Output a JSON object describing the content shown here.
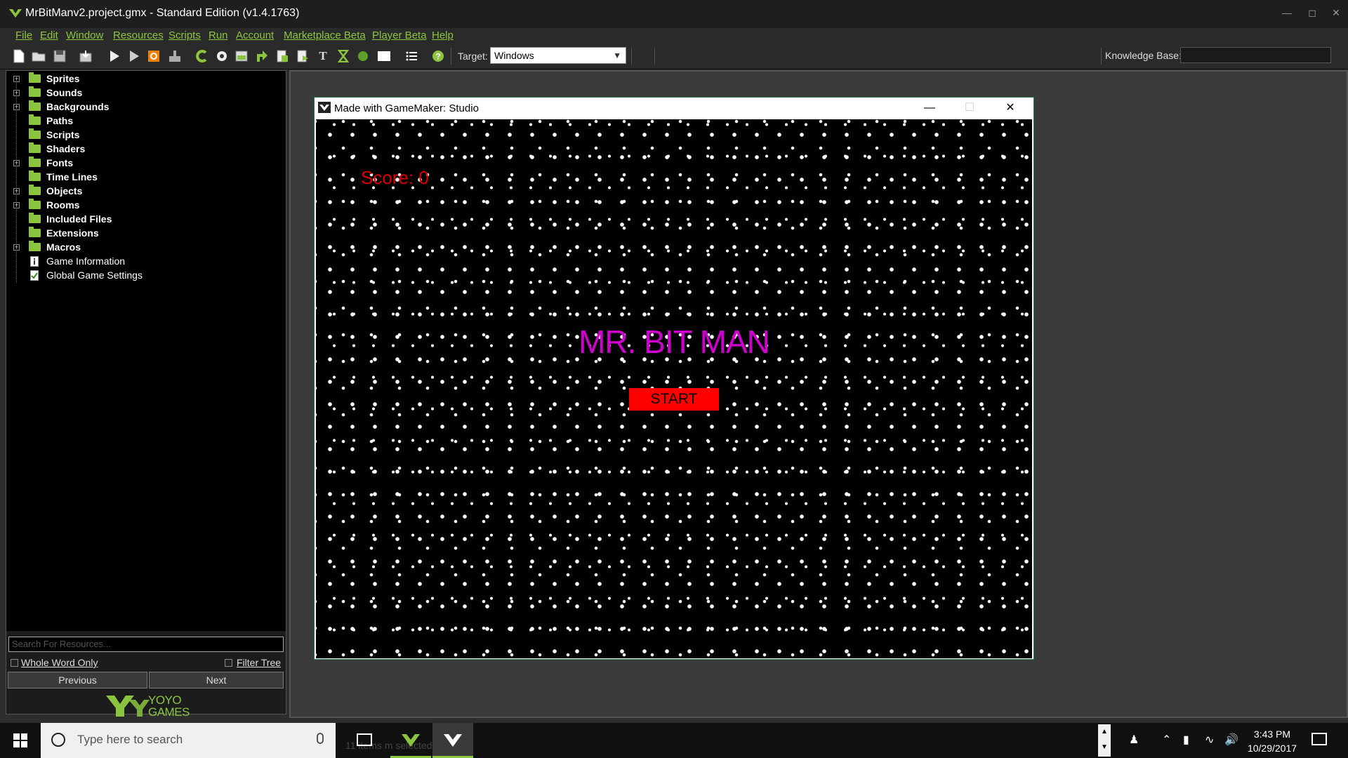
{
  "window": {
    "title": "MrBitManv2.project.gmx  -  Standard Edition (v1.4.1763)",
    "controls": [
      "minimize",
      "maximize",
      "close"
    ]
  },
  "menu": [
    "File",
    "Edit",
    "Window",
    "Resources",
    "Scripts",
    "Run",
    "Account",
    "Marketplace Beta",
    "Player Beta",
    "Help"
  ],
  "toolbar": {
    "icons": [
      "new-project-icon",
      "open-project-icon",
      "save-project-icon",
      "export-icon",
      "run-icon",
      "debug-icon",
      "stop-icon",
      "clean-icon",
      "create-sprite-icon",
      "create-sound-icon",
      "create-background-icon",
      "create-path-icon",
      "create-script-icon",
      "create-shader-icon",
      "create-font-icon",
      "create-timeline-icon",
      "create-object-icon",
      "create-room-icon",
      "game-settings-icon",
      "help-icon"
    ],
    "target_label": "Target:",
    "target_value": "Windows",
    "knowledge_base_label": "Knowledge Base:"
  },
  "resource_tree": [
    {
      "label": "Sprites",
      "expandable": true,
      "bold": true
    },
    {
      "label": "Sounds",
      "expandable": true,
      "bold": true
    },
    {
      "label": "Backgrounds",
      "expandable": true,
      "bold": true
    },
    {
      "label": "Paths",
      "expandable": false,
      "bold": true
    },
    {
      "label": "Scripts",
      "expandable": false,
      "bold": true
    },
    {
      "label": "Shaders",
      "expandable": false,
      "bold": true
    },
    {
      "label": "Fonts",
      "expandable": true,
      "bold": true
    },
    {
      "label": "Time Lines",
      "expandable": false,
      "bold": true
    },
    {
      "label": "Objects",
      "expandable": true,
      "bold": true
    },
    {
      "label": "Rooms",
      "expandable": true,
      "bold": true
    },
    {
      "label": "Included Files",
      "expandable": false,
      "bold": true
    },
    {
      "label": "Extensions",
      "expandable": false,
      "bold": true
    },
    {
      "label": "Macros",
      "expandable": true,
      "bold": true
    },
    {
      "label": "Game Information",
      "expandable": false,
      "bold": false
    },
    {
      "label": "Global Game Settings",
      "expandable": false,
      "bold": false
    }
  ],
  "resource_search": {
    "placeholder": "Search For Resources...",
    "whole_word_label": "Whole Word Only",
    "filter_tree_label": "Filter Tree",
    "previous_label": "Previous",
    "next_label": "Next"
  },
  "branding": {
    "line1": "YOYO",
    "line2": "GAMES",
    "accent": "#8bc53f"
  },
  "game_window": {
    "title": "Made with GameMaker: Studio",
    "score_text": "Score: 0",
    "game_title": "MR. BIT MAN",
    "start_label": "START",
    "colors": {
      "score": "#dd0000",
      "title": "#d000d0",
      "start_bg": "#ff0000"
    }
  },
  "taskbar": {
    "search_placeholder": "Type here to search",
    "status_ghost": "11 items    m selected   1.09 MB",
    "time": "3:43 PM",
    "date": "10/29/2017"
  }
}
